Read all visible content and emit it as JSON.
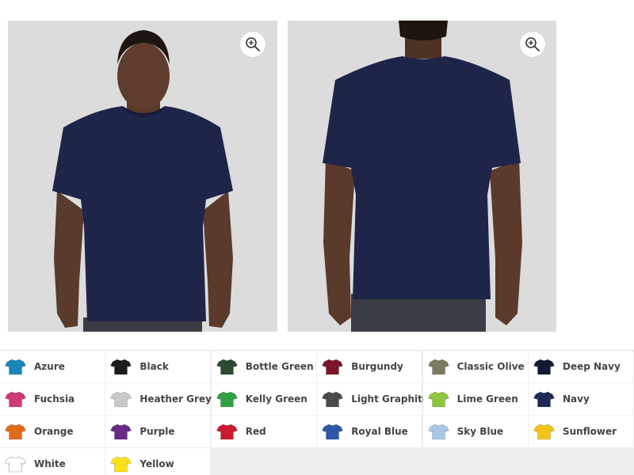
{
  "gallery": {
    "images": [
      {
        "view": "front",
        "zoom_icon": "zoom-in-icon"
      },
      {
        "view": "back",
        "zoom_icon": "zoom-in-icon"
      }
    ],
    "shirt_color": "#1f2449",
    "background_color": "#dcdcdc"
  },
  "colors": [
    {
      "name": "Azure",
      "hex": "#1a86bb"
    },
    {
      "name": "Black",
      "hex": "#1c1c1c"
    },
    {
      "name": "Bottle Green",
      "hex": "#2c4a30"
    },
    {
      "name": "Burgundy",
      "hex": "#7b1528"
    },
    {
      "name": "Classic Olive",
      "hex": "#7a7a62"
    },
    {
      "name": "Deep Navy",
      "hex": "#141a33"
    },
    {
      "name": "Fuchsia",
      "hex": "#d0387a"
    },
    {
      "name": "Heather Grey",
      "hex": "#c9c9c9"
    },
    {
      "name": "Kelly Green",
      "hex": "#30a045"
    },
    {
      "name": "Light Graphite",
      "hex": "#4a4a4a"
    },
    {
      "name": "Lime Green",
      "hex": "#8dc63f"
    },
    {
      "name": "Navy",
      "hex": "#1c2a55"
    },
    {
      "name": "Orange",
      "hex": "#e06a1a"
    },
    {
      "name": "Purple",
      "hex": "#6a2a8a"
    },
    {
      "name": "Red",
      "hex": "#cc1a2e"
    },
    {
      "name": "Royal Blue",
      "hex": "#2f57a8"
    },
    {
      "name": "Sky Blue",
      "hex": "#a8c8e8"
    },
    {
      "name": "Sunflower",
      "hex": "#f2c418"
    },
    {
      "name": "White",
      "hex": "#ffffff"
    },
    {
      "name": "Yellow",
      "hex": "#f7e21a"
    }
  ]
}
